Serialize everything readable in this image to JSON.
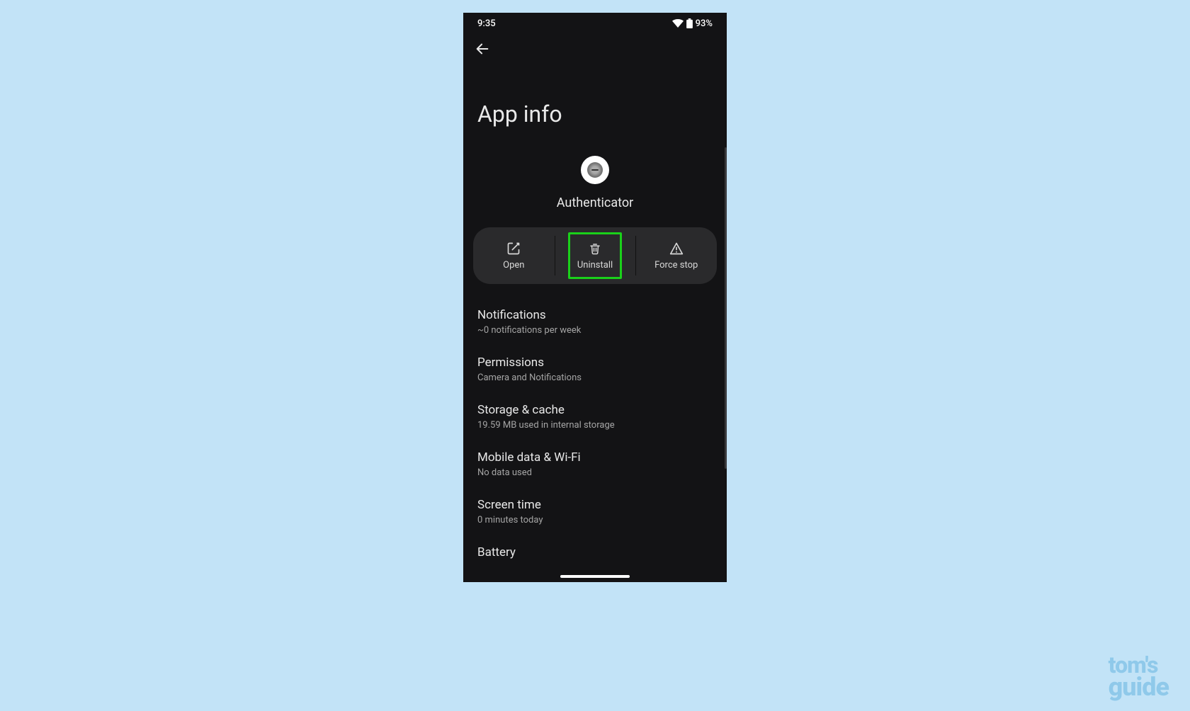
{
  "statusbar": {
    "time": "9:35",
    "battery": "93%"
  },
  "page_title": "App info",
  "app": {
    "name": "Authenticator"
  },
  "actions": {
    "open": "Open",
    "uninstall": "Uninstall",
    "force_stop": "Force stop"
  },
  "settings": [
    {
      "title": "Notifications",
      "sub": "~0 notifications per week"
    },
    {
      "title": "Permissions",
      "sub": "Camera and Notifications"
    },
    {
      "title": "Storage & cache",
      "sub": "19.59 MB used in internal storage"
    },
    {
      "title": "Mobile data & Wi-Fi",
      "sub": "No data used"
    },
    {
      "title": "Screen time",
      "sub": "0 minutes today"
    },
    {
      "title": "Battery",
      "sub": ""
    }
  ],
  "watermark": {
    "line1": "tom's",
    "line2": "guide"
  }
}
